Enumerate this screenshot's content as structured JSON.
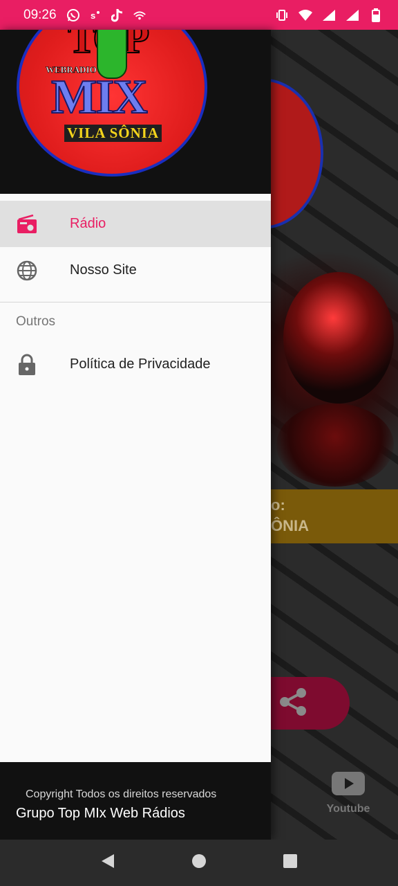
{
  "status_bar": {
    "time": "09:26",
    "left_icons": [
      "whatsapp-icon",
      "notification-icon",
      "tiktok-icon",
      "wifi-calling-icon"
    ],
    "right_icons": [
      "vibrate-icon",
      "wifi-icon",
      "signal-icon",
      "signal-icon",
      "battery-icon"
    ]
  },
  "drawer": {
    "logo": {
      "top_text": "TOP",
      "webradio_text": "WEBRADIO",
      "mix_text": "MIX",
      "vila_text": "VILA SÔNIA"
    },
    "menu": [
      {
        "label": "Rádio",
        "icon": "radio-icon",
        "active": true
      },
      {
        "label": "Nosso Site",
        "icon": "globe-icon",
        "active": false
      }
    ],
    "section_title": "Outros",
    "section_items": [
      {
        "label": "Política de Privacidade",
        "icon": "lock-icon"
      }
    ],
    "footer": {
      "copyright": "Copyright Todos os direitos reservados",
      "group": "Grupo Top MIx Web Rádios"
    }
  },
  "background": {
    "title_line1": "o:",
    "title_line2": "ÔNIA",
    "youtube_label": "Youtube"
  },
  "colors": {
    "accent": "#e91e63",
    "drawer_bg": "#fafafa",
    "active_bg": "#e0e0e0",
    "header_bg": "#111111"
  }
}
